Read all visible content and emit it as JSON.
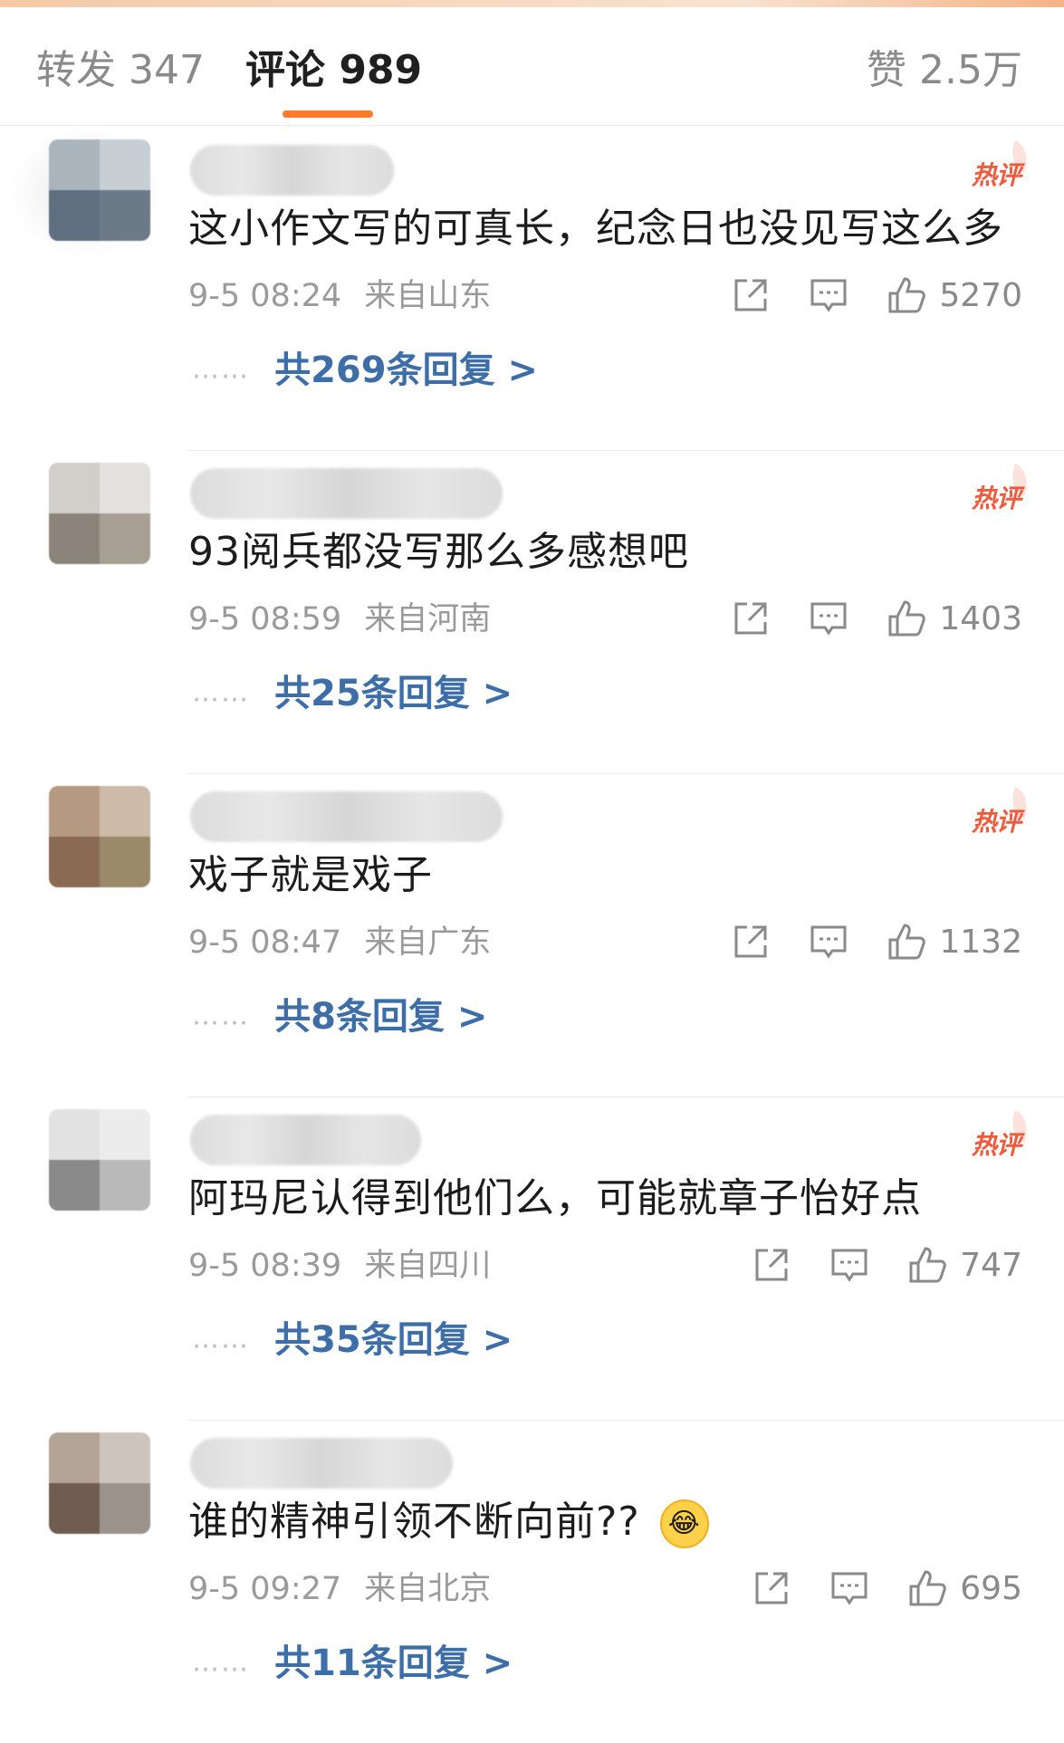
{
  "tabs": {
    "repost": "转发 347",
    "comments": "评论 989",
    "likes": "赞 2.5万"
  },
  "colors": {
    "accent": "#ff7b2c",
    "link": "#3e6ea8",
    "hot": "#f05a3c"
  },
  "hot_label": "热评",
  "comments": [
    {
      "text": "这小作文写的可真长，纪念日也没见写这么多",
      "time": "9-5 08:24",
      "location": "来自山东",
      "likes": "5270",
      "replies": "共269条回复 >"
    },
    {
      "text": "93阅兵都没写那么多感想吧",
      "time": "9-5 08:59",
      "location": "来自河南",
      "likes": "1403",
      "replies": "共25条回复 >"
    },
    {
      "text": "戏子就是戏子",
      "time": "9-5 08:47",
      "location": "来自广东",
      "likes": "1132",
      "replies": "共8条回复 >"
    },
    {
      "text": "阿玛尼认得到他们么，可能就章子怡好点",
      "time": "9-5 08:39",
      "location": "来自四川",
      "likes": "747",
      "replies": "共35条回复 >"
    },
    {
      "text": "谁的精神引领不断向前??",
      "time": "9-5 09:27",
      "location": "来自北京",
      "likes": "695",
      "replies": "共11条回复 >",
      "emoji": "laughing-crying-emoji"
    }
  ],
  "reply_dots": "……",
  "icons": [
    "share-icon",
    "comment-icon",
    "like-icon"
  ]
}
